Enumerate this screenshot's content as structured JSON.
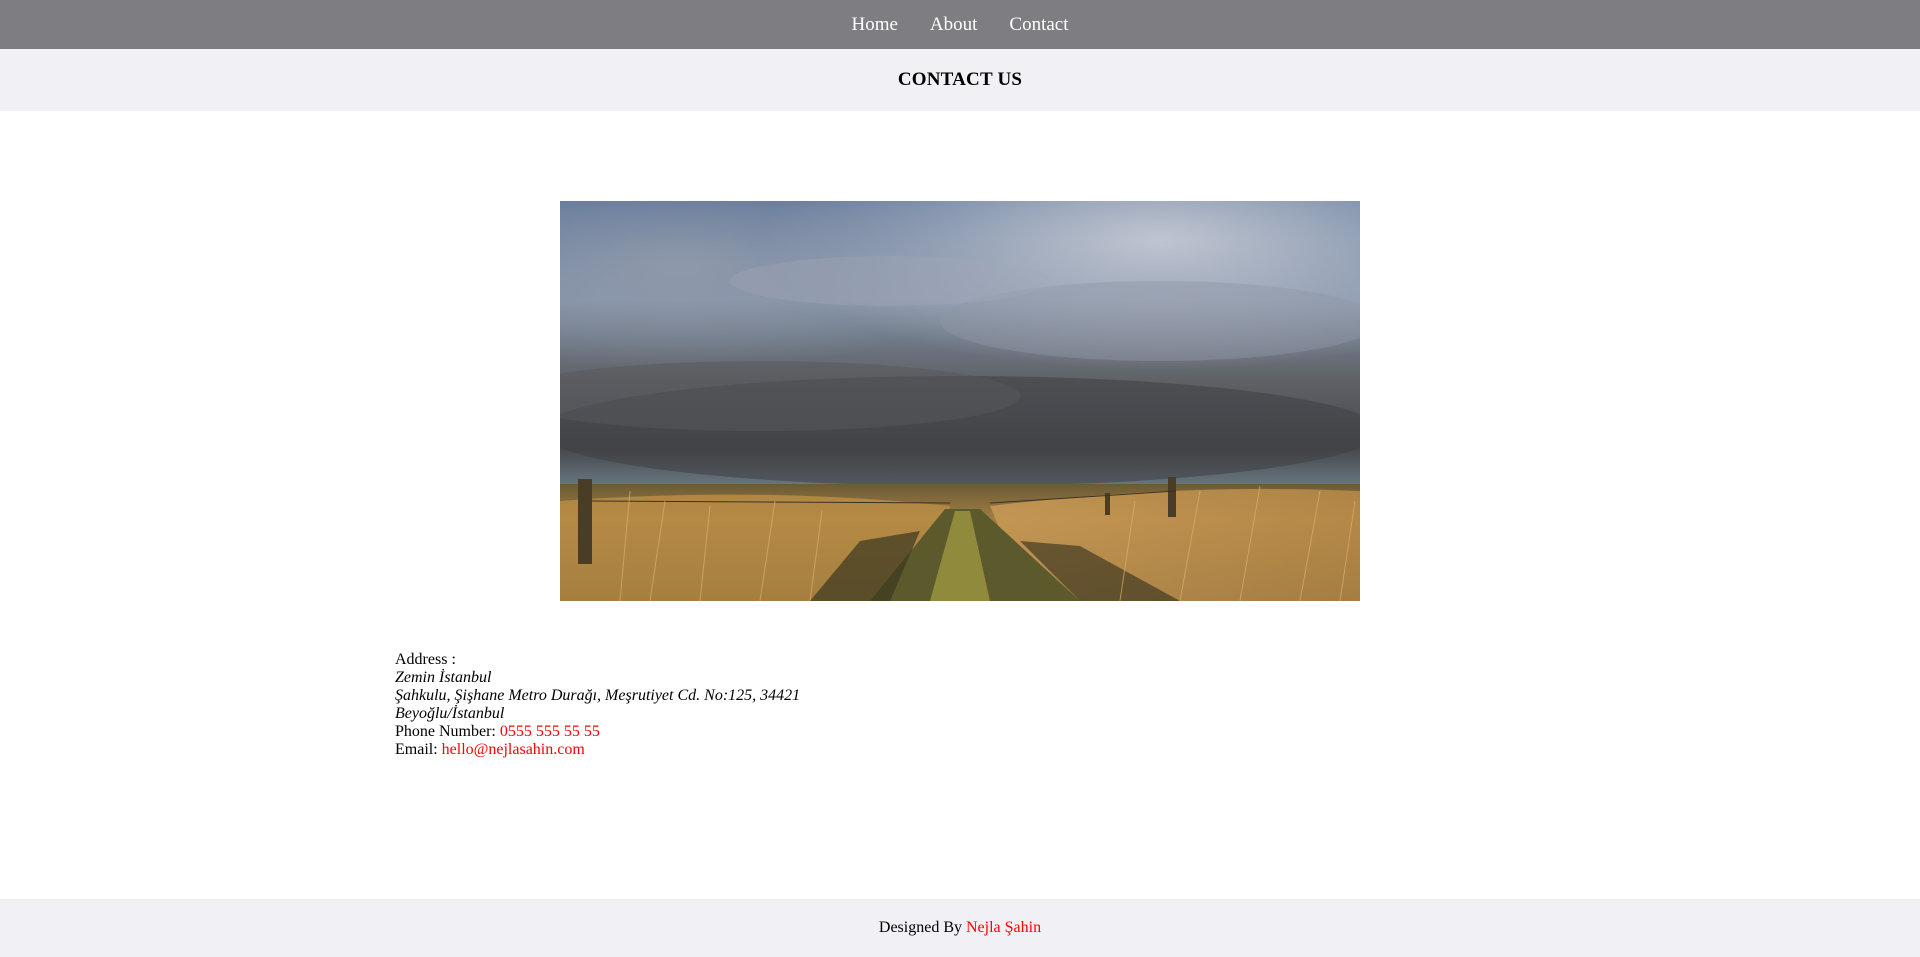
{
  "nav": {
    "items": [
      {
        "label": "Home"
      },
      {
        "label": "About"
      },
      {
        "label": "Contact"
      }
    ]
  },
  "page": {
    "title": "CONTACT US"
  },
  "hero": {
    "icon": "landscape-photo"
  },
  "contact": {
    "address_label": "Address :",
    "address_line1": "Zemin İstanbul",
    "address_line2": "Şahkulu, Şişhane Metro Durağı, Meşrutiyet Cd. No:125, 34421",
    "address_line3": "Beyoğlu/İstanbul",
    "phone_label": "Phone Number:",
    "phone_value": "0555 555 55 55",
    "email_label": "Email:",
    "email_value": "hello@nejlasahin.com"
  },
  "footer": {
    "designed_by": "Designed By",
    "author": "Nejla Şahin"
  },
  "colors": {
    "nav_bg": "#7e7d82",
    "band_bg": "#f1f0f5",
    "link": "#ff0000"
  }
}
